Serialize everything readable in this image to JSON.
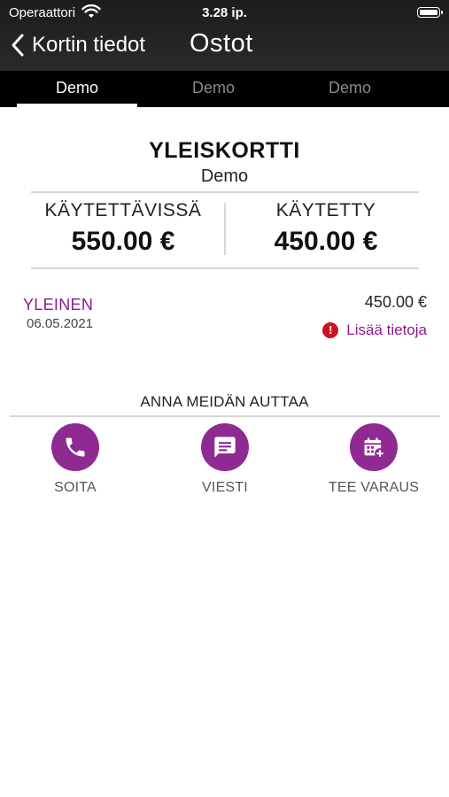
{
  "status_bar": {
    "carrier": "Operaattori",
    "time": "3.28 ip."
  },
  "nav": {
    "back_label": "Kortin tiedot",
    "title": "Ostot"
  },
  "tabs": [
    {
      "label": "Demo",
      "active": true
    },
    {
      "label": "Demo",
      "active": false
    },
    {
      "label": "Demo",
      "active": false
    }
  ],
  "card": {
    "title": "YLEISKORTTI",
    "subtitle": "Demo",
    "available_label": "KÄYTETTÄVISSÄ",
    "available_value": "550.00 €",
    "used_label": "KÄYTETTY",
    "used_value": "450.00 €"
  },
  "transactions": [
    {
      "name": "YLEINEN",
      "date": "06.05.2021",
      "amount": "450.00 €",
      "more_label": "Lisää tietoja"
    }
  ],
  "help": {
    "title": "ANNA MEIDÄN AUTTAA",
    "actions": [
      {
        "label": "SOITA",
        "icon": "phone-icon"
      },
      {
        "label": "VIESTI",
        "icon": "message-icon"
      },
      {
        "label": "TEE VARAUS",
        "icon": "calendar-add-icon"
      }
    ]
  },
  "colors": {
    "accent": "#8e2a92",
    "alert": "#d0101e",
    "header_bg": "#1c1c1c",
    "tab_bg": "#000000"
  }
}
